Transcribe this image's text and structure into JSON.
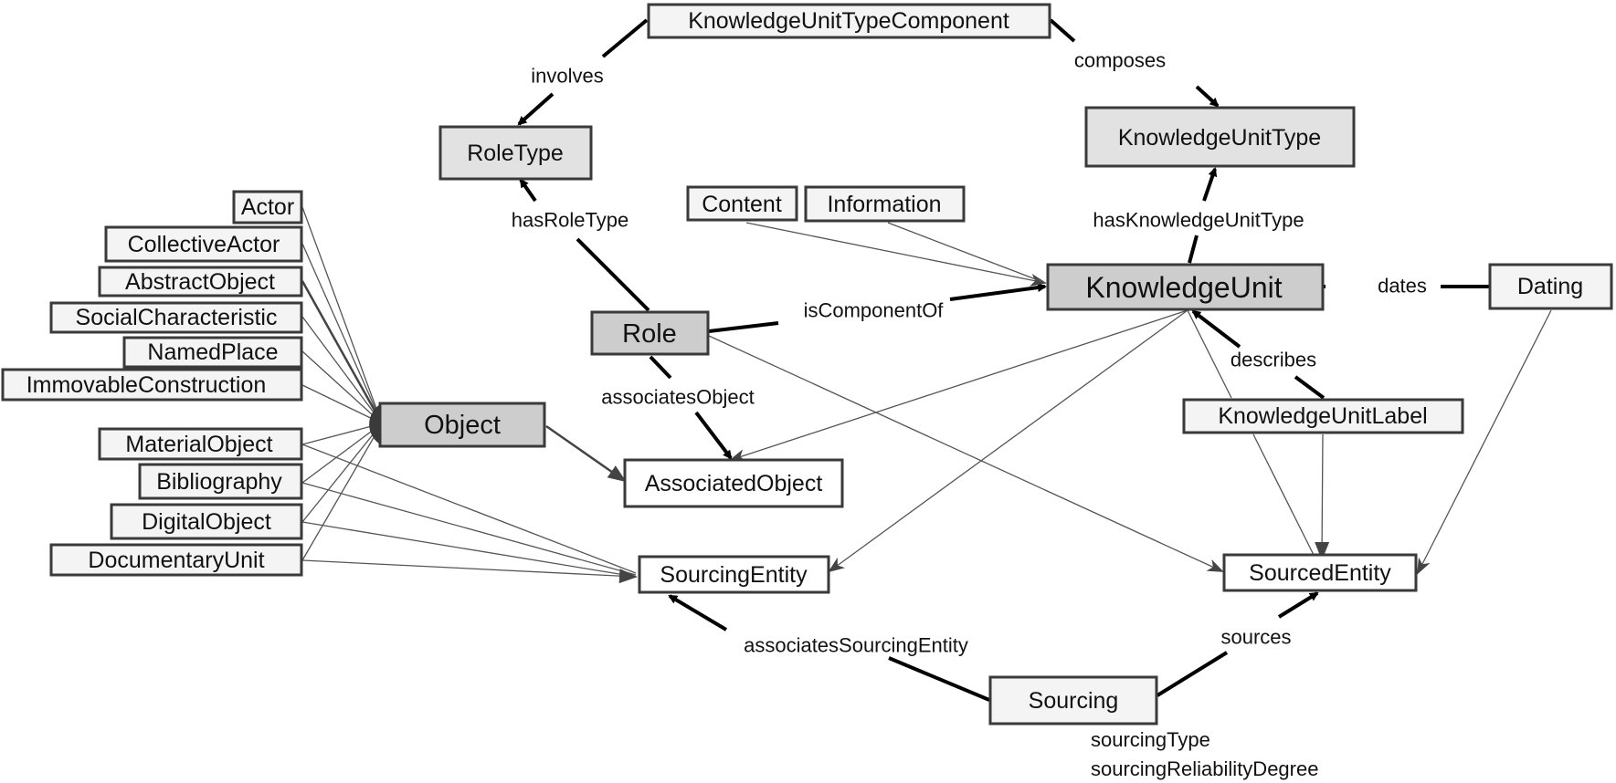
{
  "diagram": {
    "nodes": {
      "kutc": "KnowledgeUnitTypeComponent",
      "roleType": "RoleType",
      "kut": "KnowledgeUnitType",
      "content": "Content",
      "information": "Information",
      "ku": "KnowledgeUnit",
      "dating": "Dating",
      "role": "Role",
      "object": "Object",
      "associatedObject": "AssociatedObject",
      "kuLabel": "KnowledgeUnitLabel",
      "sourcingEntity": "SourcingEntity",
      "sourcedEntity": "SourcedEntity",
      "sourcing": "Sourcing",
      "actor": "Actor",
      "collectiveActor": "CollectiveActor",
      "abstractObject": "AbstractObject",
      "socialCharacteristic": "SocialCharacteristic",
      "namedPlace": "NamedPlace",
      "immovableConstruction": "ImmovableConstruction",
      "materialObject": "MaterialObject",
      "bibliography": "Bibliography",
      "digitalObject": "DigitalObject",
      "documentaryUnit": "DocumentaryUnit"
    },
    "edges": {
      "involves": "involves",
      "composes": "composes",
      "hasRoleType": "hasRoleType",
      "hasKnowledgeUnitType": "hasKnowledgeUnitType",
      "isComponentOf": "isComponentOf",
      "dates": "dates",
      "associatesObject": "associatesObject",
      "describes": "describes",
      "associatesSourcingEntity": "associatesSourcingEntity",
      "sources": "sources"
    },
    "sourcing_attributes": [
      "sourcingType",
      "sourcingReliabilityDegree"
    ]
  }
}
